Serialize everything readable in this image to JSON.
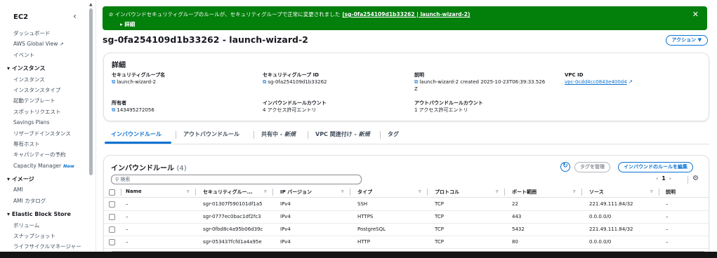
{
  "sidebar": {
    "title": "EC2",
    "collapse_icon": "chevron-left-icon",
    "items_top": [
      {
        "label": "ダッシュボード"
      },
      {
        "label": "AWS Global View"
      },
      {
        "label": "イベント"
      }
    ],
    "sections": [
      {
        "label": "インスタンス",
        "items": [
          "インスタンス",
          "インスタンスタイプ",
          "起動テンプレート",
          "スポットリクエスト",
          "Savings Plans",
          "リザーブドインスタンス",
          "専有ホスト",
          "キャパシティーの予約",
          "Capacity Manager"
        ]
      },
      {
        "label": "イメージ",
        "items": [
          "AMI",
          "AMI カタログ"
        ]
      },
      {
        "label": "Elastic Block Store",
        "items": [
          "ボリューム",
          "スナップショット",
          "ライフサイクルマネージャー"
        ]
      }
    ],
    "new_badge": "New"
  },
  "flash": {
    "message": "インバウンドセキュリティグループのルールが、セキュリティグループで正常に変更されました",
    "link": "(sg-0fa254109d1b33262 | launch-wizard-2)",
    "details": "詳細",
    "close_icon": "close-icon"
  },
  "page": {
    "title": "sg-0fa254109d1b33262 - launch-wizard-2",
    "action_button": "アクション ▼"
  },
  "details": {
    "title": "詳細",
    "fields": [
      {
        "label": "セキュリティグループ名",
        "value": "launch-wizard-2"
      },
      {
        "label": "セキュリティグループ ID",
        "value": "sg-0fa254109d1b33262"
      },
      {
        "label": "説明",
        "value": "launch-wizard-2 created 2025-10-23T06:39:33.526",
        "value2": "Z"
      },
      {
        "label": "VPC ID",
        "value": "vpc-0cdd4cc0843e400d4"
      },
      {
        "label": "所有者",
        "value": "143495272056"
      },
      {
        "label": "インバウンドルールカウント",
        "value": "4 アクセス許可エントリ"
      },
      {
        "label": "アウトバウンドルールカウント",
        "value": "1 アクセス許可エントリ"
      }
    ]
  },
  "tabs": [
    {
      "label": "インバウンドルール"
    },
    {
      "label": "アウトバウンドルール"
    },
    {
      "label": "共有中 - ",
      "em": "新規"
    },
    {
      "label": "VPC 関連付け - ",
      "em": "新規"
    },
    {
      "label": "タグ"
    }
  ],
  "rules": {
    "title": "インバウンドルール",
    "count": "(4)",
    "manage_tags": "タグを管理",
    "edit_rules": "インバウンドのルールを編集",
    "search_placeholder": "検索",
    "page_number": "1",
    "columns": [
      "Name",
      "セキュリティグルー...",
      "IP バージョン",
      "タイプ",
      "プロトコル",
      "ポート範囲",
      "ソース",
      "説明"
    ],
    "rows": [
      {
        "name": "–",
        "id": "sgr-01307f590101df1a5",
        "ipver": "IPv4",
        "type": "SSH",
        "protocol": "TCP",
        "port": "22",
        "source": "221.49.111.84/32",
        "desc": "–"
      },
      {
        "name": "–",
        "id": "sgr-0777ec0bac1df2fc3",
        "ipver": "IPv4",
        "type": "HTTPS",
        "protocol": "TCP",
        "port": "443",
        "source": "0.0.0.0/0",
        "desc": "–"
      },
      {
        "name": "–",
        "id": "sgr-0fbd8c4a95b06d39c",
        "ipver": "IPv4",
        "type": "PostgreSQL",
        "protocol": "TCP",
        "port": "5432",
        "source": "221.49.111.84/32",
        "desc": "–"
      },
      {
        "name": "–",
        "id": "sgr-053437fcfd1a4a95e",
        "ipver": "IPv4",
        "type": "HTTP",
        "protocol": "TCP",
        "port": "80",
        "source": "0.0.0.0/0",
        "desc": "–"
      }
    ]
  },
  "colors": {
    "accent": "#0972d3",
    "success": "#037f0c"
  }
}
